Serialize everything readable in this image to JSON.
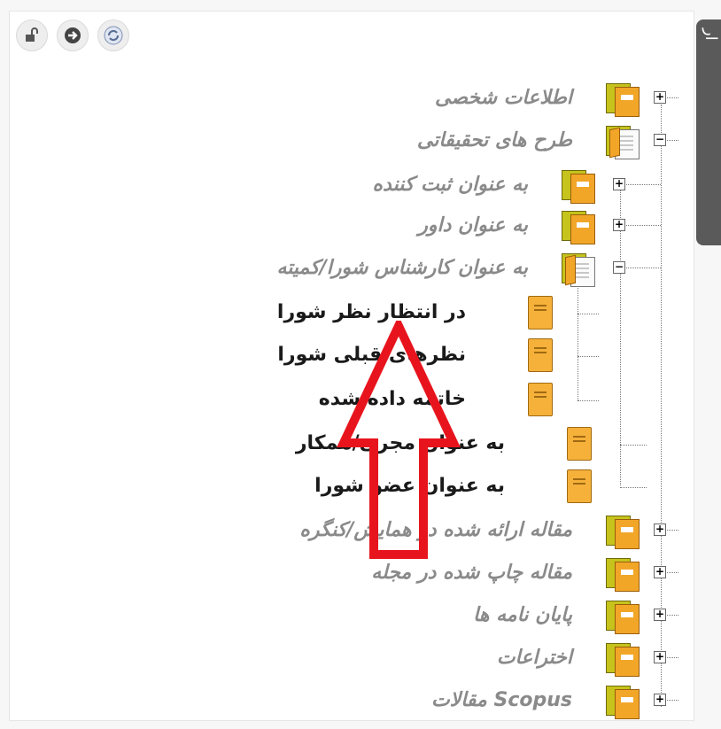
{
  "toolbar": {
    "icons": [
      "unlock-icon",
      "forward-icon",
      "refresh-icon"
    ]
  },
  "side_tab": {
    "label": "ار"
  },
  "tree": {
    "items": [
      {
        "label": "اطلاعات شخصی",
        "toggle": "+"
      },
      {
        "label": "طرح های تحقیقاتی",
        "toggle": "−"
      },
      {
        "label": "به عنوان ثبت کننده",
        "toggle": "+"
      },
      {
        "label": "به عنوان داور",
        "toggle": "+"
      },
      {
        "label": "به عنوان کارشناس شورا/کمیته",
        "toggle": "−"
      },
      {
        "label": "در انتظار نظر شورا"
      },
      {
        "label": "نظرهای قبلی شورا"
      },
      {
        "label": "خاتمه داده شده"
      },
      {
        "label": "به عنوان مجری/همکار"
      },
      {
        "label": "به عنوان عضو شورا"
      },
      {
        "label": "مقاله ارائه شده در همایش/کنگره",
        "toggle": "+"
      },
      {
        "label": "مقاله چاپ شده در مجله",
        "toggle": "+"
      },
      {
        "label": "پایان نامه ها",
        "toggle": "+"
      },
      {
        "label": "اختراعات",
        "toggle": "+"
      },
      {
        "label": "مقالات Scopus",
        "toggle": "+"
      }
    ]
  },
  "annotation": {
    "arrow_color": "#e8141d"
  }
}
